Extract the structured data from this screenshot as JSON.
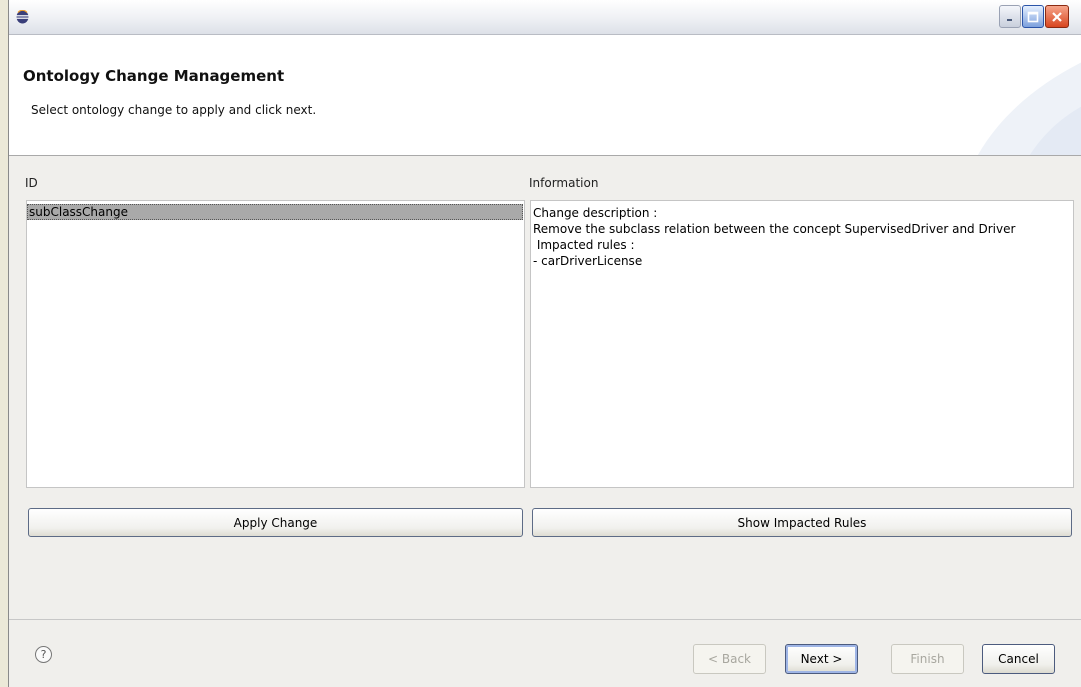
{
  "window": {
    "title": ""
  },
  "banner": {
    "title": "Ontology Change Management",
    "description": "Select ontology change to apply and click next."
  },
  "id_column": {
    "label": "ID",
    "items": [
      "subClassChange"
    ]
  },
  "info_column": {
    "label": "Information",
    "lines": [
      "Change description :",
      "Remove the subclass relation between the concept SupervisedDriver and Driver",
      " Impacted rules :",
      "- carDriverLicense"
    ]
  },
  "actions": {
    "apply_change": "Apply Change",
    "show_impacted_rules": "Show Impacted Rules"
  },
  "footer": {
    "help_glyph": "?",
    "back": "< Back",
    "next": "Next >",
    "finish": "Finish",
    "cancel": "Cancel"
  },
  "colors": {
    "selection": "#a9a9a9",
    "close_button": "#d8461f",
    "maximize_button": "#7da0dd"
  }
}
